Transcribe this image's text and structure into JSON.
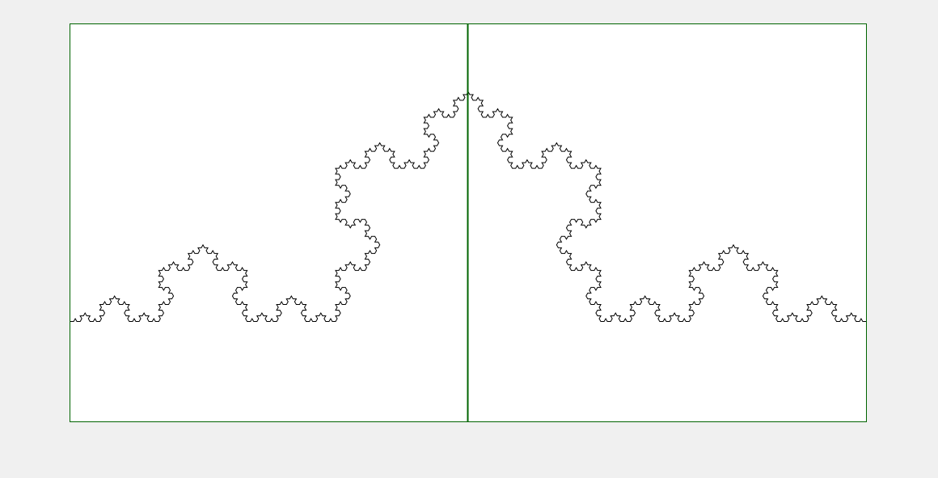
{
  "figure": {
    "kind": "koch-curve",
    "iterations": 5,
    "curve_color": "#000000",
    "frame_color": "#006400",
    "divider_color": "#006400",
    "canvas_background": "#ffffff",
    "page_background": "#f0f0f0"
  }
}
